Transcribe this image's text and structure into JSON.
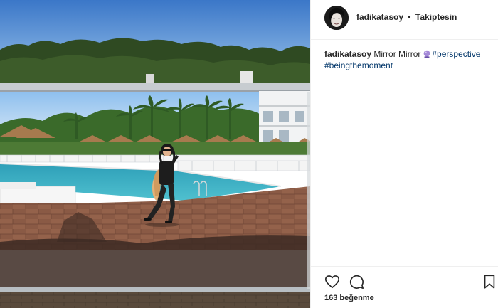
{
  "post": {
    "username": "fadikatasoy",
    "separator": "•",
    "follow_status": "Takiptesin",
    "caption": {
      "username": "fadikatasoy",
      "text": "Mirror Mirror",
      "emoji": "crystal-ball-emoji",
      "hashtags": [
        "#perspective",
        "#beingthemoment"
      ]
    },
    "likes_text": "163 beğenme"
  },
  "icons": {
    "like": "heart-icon",
    "comment": "comment-icon",
    "save": "bookmark-icon"
  },
  "colors": {
    "hashtag": "#003569",
    "text": "#262626",
    "divider": "#efefef"
  }
}
